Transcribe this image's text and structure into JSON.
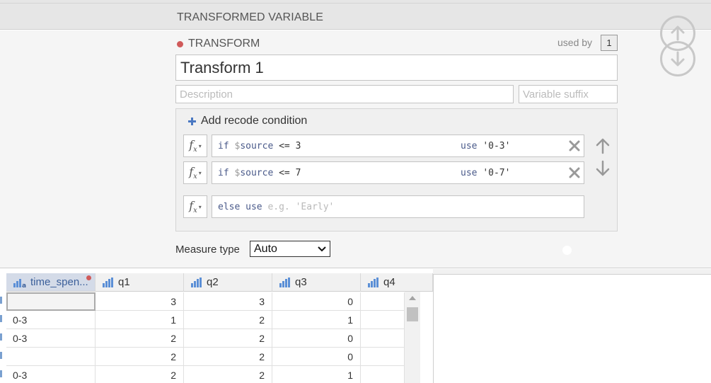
{
  "header": {
    "title": "TRANSFORMED VARIABLE"
  },
  "transform": {
    "section_label": "TRANSFORM",
    "used_by_label": "used by",
    "used_by_count": "1",
    "name_value": "Transform 1",
    "description_placeholder": "Description",
    "suffix_placeholder": "Variable suffix",
    "add_recode_label": "Add recode condition",
    "conditions": [
      {
        "if_kw": "if",
        "var_prefix": "$",
        "var": "source",
        "op": "<=",
        "value": "3",
        "use_kw": "use",
        "use_value": "'0-3'"
      },
      {
        "if_kw": "if",
        "var_prefix": "$",
        "var": "source",
        "op": "<=",
        "value": "7",
        "use_kw": "use",
        "use_value": "'0-7'"
      }
    ],
    "else_kw": "else use",
    "else_placeholder": "e.g. 'Early'",
    "fx_label": "f",
    "fx_sub": "x",
    "measure_type_label": "Measure type",
    "measure_type_value": "Auto"
  },
  "grid": {
    "columns": [
      {
        "name": "time_spen...",
        "selected": true
      },
      {
        "name": "q1",
        "selected": false
      },
      {
        "name": "q2",
        "selected": false
      },
      {
        "name": "q3",
        "selected": false
      },
      {
        "name": "q4",
        "selected": false
      }
    ],
    "rows": [
      [
        "",
        "3",
        "3",
        "0",
        ""
      ],
      [
        "0-3",
        "1",
        "2",
        "1",
        ""
      ],
      [
        "0-3",
        "2",
        "2",
        "0",
        ""
      ],
      [
        "",
        "2",
        "2",
        "0",
        ""
      ],
      [
        "0-3",
        "2",
        "2",
        "1",
        ""
      ]
    ]
  },
  "colors": {
    "accent": "#4a78c2",
    "red_dot": "#d05a5a",
    "header_bg": "#e6e6e6"
  }
}
